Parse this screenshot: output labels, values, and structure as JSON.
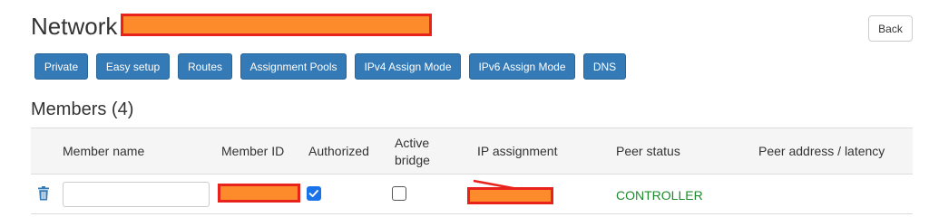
{
  "header": {
    "title": "Network",
    "back_label": "Back"
  },
  "toolbar": {
    "buttons": [
      {
        "label": "Private"
      },
      {
        "label": "Easy setup"
      },
      {
        "label": "Routes"
      },
      {
        "label": "Assignment Pools"
      },
      {
        "label": "IPv4 Assign Mode"
      },
      {
        "label": "IPv6 Assign Mode"
      },
      {
        "label": "DNS"
      }
    ]
  },
  "members": {
    "heading": "Members (4)",
    "columns": {
      "member_name": "Member name",
      "member_id": "Member ID",
      "authorized": "Authorized",
      "active_bridge_line1": "Active",
      "active_bridge_line2": "bridge",
      "ip_assignment": "IP assignment",
      "peer_status": "Peer status",
      "peer_address": "Peer address / latency"
    },
    "rows": [
      {
        "member_name": "",
        "authorized": true,
        "active_bridge": false,
        "peer_status": "CONTROLLER",
        "peer_address": ""
      }
    ]
  },
  "colors": {
    "primary_button": "#337ab7",
    "status_controller": "#1e8a2e",
    "redaction_fill": "#fd8a2b",
    "redaction_border": "#e8231c",
    "checkbox_checked": "#1a73e8",
    "trash_icon": "#337ab7"
  },
  "icons": {
    "delete": "trash-icon",
    "authorized_checked": "checkmark-icon"
  }
}
